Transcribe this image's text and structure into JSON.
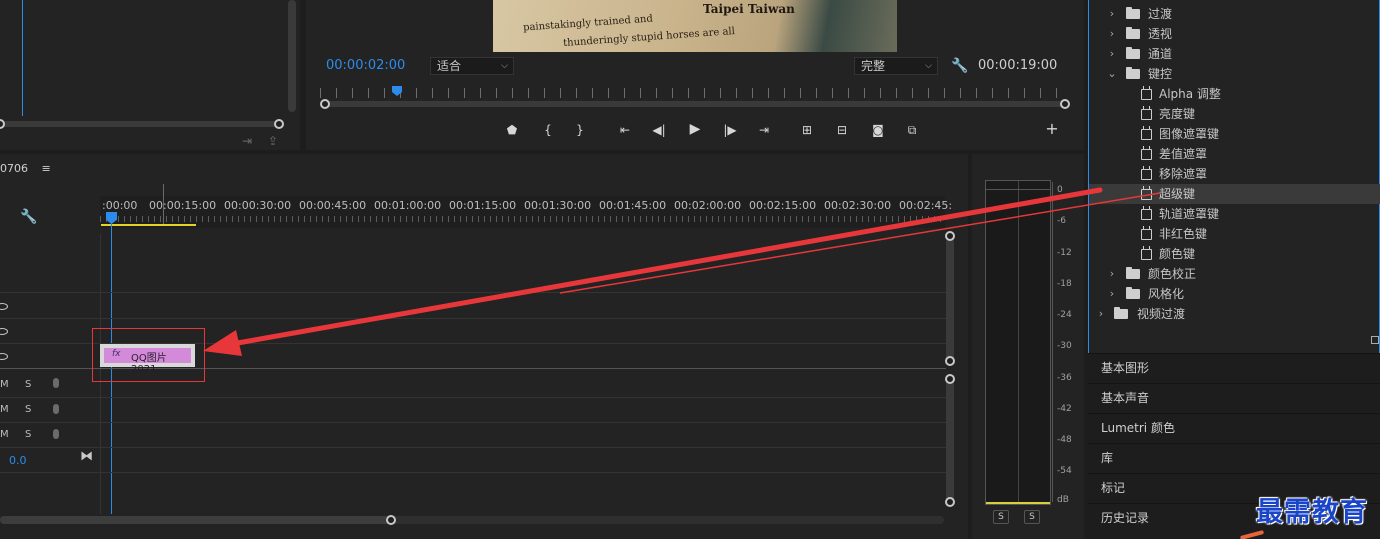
{
  "program_monitor": {
    "current_timecode": "00:00:02:00",
    "fit_select": "适合",
    "quality_select": "完整",
    "duration_timecode": "00:00:19:00",
    "preview_text_1": "Taipei Taiwan",
    "preview_text_2": "painstakingly trained and",
    "preview_text_3": "thunderingly stupid horses are all"
  },
  "timeline": {
    "sequence_name": "0706",
    "ruler_labels": [
      ":00:00",
      "00:00:15:00",
      "00:00:30:00",
      "00:00:45:00",
      "00:01:00:00",
      "00:01:15:00",
      "00:01:30:00",
      "00:01:45:00",
      "00:02:00:00",
      "00:02:15:00",
      "00:02:30:00",
      "00:02:45:"
    ],
    "clip_name": "QQ图片2021",
    "clip_fx_label": "fx",
    "audio_track_labels": [
      "M",
      "S",
      "M",
      "S",
      "M",
      "S"
    ],
    "master_value": "0.0"
  },
  "audio_meter": {
    "db_labels": [
      "0",
      "-6",
      "-12",
      "-18",
      "-24",
      "-30",
      "-36",
      "-42",
      "-48",
      "-54",
      "dB"
    ],
    "solo_labels": [
      "S",
      "S"
    ]
  },
  "effects_tree": {
    "items": [
      {
        "label": "过渡",
        "type": "folder"
      },
      {
        "label": "透视",
        "type": "folder"
      },
      {
        "label": "通道",
        "type": "folder"
      },
      {
        "label": "键控",
        "type": "folder-open"
      },
      {
        "label": "Alpha 调整",
        "type": "effect"
      },
      {
        "label": "亮度键",
        "type": "effect"
      },
      {
        "label": "图像遮罩键",
        "type": "effect"
      },
      {
        "label": "差值遮罩",
        "type": "effect"
      },
      {
        "label": "移除遮罩",
        "type": "effect"
      },
      {
        "label": "超级键",
        "type": "effect",
        "selected": true
      },
      {
        "label": "轨道遮罩键",
        "type": "effect"
      },
      {
        "label": "非红色键",
        "type": "effect"
      },
      {
        "label": "颜色键",
        "type": "effect"
      },
      {
        "label": "颜色校正",
        "type": "folder"
      },
      {
        "label": "风格化",
        "type": "folder"
      },
      {
        "label": "视频过渡",
        "type": "folder-root"
      }
    ]
  },
  "side_panels": [
    "基本图形",
    "基本声音",
    "Lumetri 颜色",
    "库",
    "标记",
    "历史记录"
  ],
  "watermark": "最需教育",
  "colors": {
    "accent_blue": "#2d8ceb",
    "clip_pink": "#d38bd9",
    "annotation_red": "#e8373a",
    "watermark_blue": "#1a45c9"
  }
}
